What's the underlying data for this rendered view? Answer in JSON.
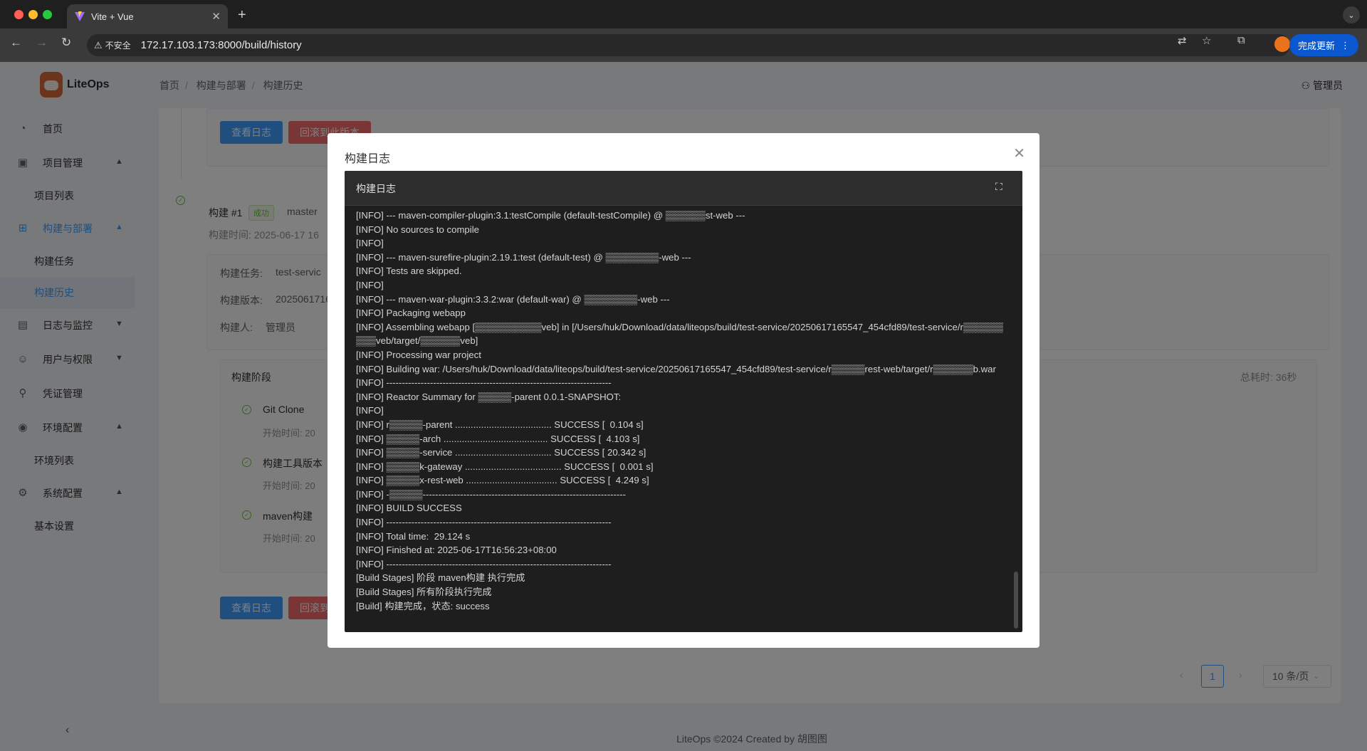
{
  "browser": {
    "tab_title": "Vite + Vue",
    "insecure_label": "不安全",
    "url": "172.17.103.173:8000/build/history",
    "update_label": "完成更新"
  },
  "app": {
    "logo_text": "LiteOps",
    "menu": [
      {
        "label": "首页"
      },
      {
        "label": "项目管理"
      },
      {
        "label": "项目列表"
      },
      {
        "label": "构建与部署"
      },
      {
        "label": "构建任务"
      },
      {
        "label": "构建历史"
      },
      {
        "label": "日志与监控"
      },
      {
        "label": "用户与权限"
      },
      {
        "label": "凭证管理"
      },
      {
        "label": "环境配置"
      },
      {
        "label": "环境列表"
      },
      {
        "label": "系统配置"
      },
      {
        "label": "基本设置"
      }
    ],
    "breadcrumb": [
      "首页",
      "构建与部署",
      "构建历史"
    ],
    "user": "管理员",
    "footer": "LiteOps ©2024 Created by 胡图图"
  },
  "background": {
    "view_log": "查看日志",
    "rollback": "回滚到此版本",
    "rollback_short": "回滚到",
    "build_title": "构建 #1",
    "status_badge": "成功",
    "branch": "master",
    "build_time_prefix": "构建时间: 2025-06-17 16",
    "task_label": "构建任务:",
    "task_value": "test-servic",
    "version_label": "构建版本:",
    "version_value": "2025061716",
    "builder_label": "构建人:",
    "builder_value": "管理员",
    "stages_title": "构建阶段",
    "total_time": "总耗时: 36秒",
    "stages": [
      {
        "name": "Git Clone",
        "time_prefix": "开始时间: 20"
      },
      {
        "name": "构建工具版本",
        "time_prefix": "开始时间: 20"
      },
      {
        "name": "maven构建",
        "time_prefix": "开始时间: 20"
      }
    ],
    "page": "1",
    "page_size": "10 条/页"
  },
  "dialog": {
    "title": "构建日志",
    "panel_title": "构建日志",
    "lines": [
      "[INFO] --- maven-compiler-plugin:3.1:testCompile (default-testCompile) @ ▒▒▒▒▒▒st-web ---",
      "[INFO] No sources to compile",
      "[INFO]",
      "[INFO] --- maven-surefire-plugin:2.19.1:test (default-test) @ ▒▒▒▒▒▒▒▒-web ---",
      "[INFO] Tests are skipped.",
      "[INFO]",
      "[INFO] --- maven-war-plugin:3.3.2:war (default-war) @ ▒▒▒▒▒▒▒▒-web ---",
      "[INFO] Packaging webapp",
      "[INFO] Assembling webapp [▒▒▒▒▒▒▒▒▒▒veb] in [/Users/huk/Download/data/liteops/build/test-service/20250617165547_454cfd89/test-service/r▒▒▒▒▒▒▒▒▒veb/target/▒▒▒▒▒▒veb]",
      "[INFO] Processing war project",
      "[INFO] Building war: /Users/huk/Download/data/liteops/build/test-service/20250617165547_454cfd89/test-service/r▒▒▒▒▒rest-web/target/r▒▒▒▒▒▒b.war",
      "[INFO] ------------------------------------------------------------------------",
      "[INFO] Reactor Summary for ▒▒▒▒▒-parent 0.0.1-SNAPSHOT:",
      "[INFO]",
      "[INFO] r▒▒▒▒▒-parent ..................................... SUCCESS [  0.104 s]",
      "[INFO] ▒▒▒▒▒-arch ........................................ SUCCESS [  4.103 s]",
      "[INFO] ▒▒▒▒▒-service ..................................... SUCCESS [ 20.342 s]",
      "[INFO] ▒▒▒▒▒k-gateway ..................................... SUCCESS [  0.001 s]",
      "[INFO] ▒▒▒▒▒x-rest-web ................................... SUCCESS [  4.249 s]",
      "[INFO] -▒▒▒▒▒-----------------------------------------------------------------",
      "[INFO] BUILD SUCCESS",
      "[INFO] ------------------------------------------------------------------------",
      "[INFO] Total time:  29.124 s",
      "[INFO] Finished at: 2025-06-17T16:56:23+08:00",
      "[INFO] ------------------------------------------------------------------------",
      "[Build Stages] 阶段 maven构建 执行完成",
      "[Build Stages] 所有阶段执行完成",
      "[Build] 构建完成，状态: success"
    ]
  }
}
